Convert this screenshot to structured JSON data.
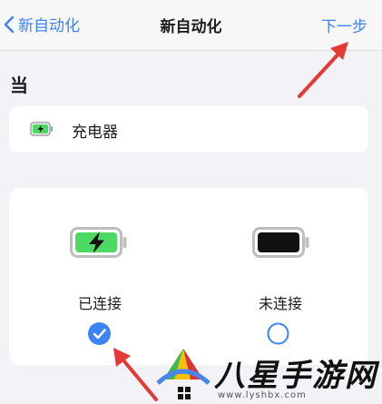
{
  "nav": {
    "back_label": "新自动化",
    "title": "新自动化",
    "next_label": "下一步"
  },
  "section": {
    "label": "当"
  },
  "trigger": {
    "label": "充电器",
    "icon": "battery-charging-icon"
  },
  "options": [
    {
      "label": "已连接",
      "icon": "battery-charging-icon",
      "selected": true
    },
    {
      "label": "未连接",
      "icon": "battery-full-icon",
      "selected": false
    }
  ],
  "colors": {
    "accent": "#3b82f6",
    "charge_green": "#4cd964",
    "annotation_red": "#e53935",
    "background": "#f2f2f7"
  },
  "watermark": {
    "text": "八星手游网",
    "url": "www.lyshbx.com"
  }
}
